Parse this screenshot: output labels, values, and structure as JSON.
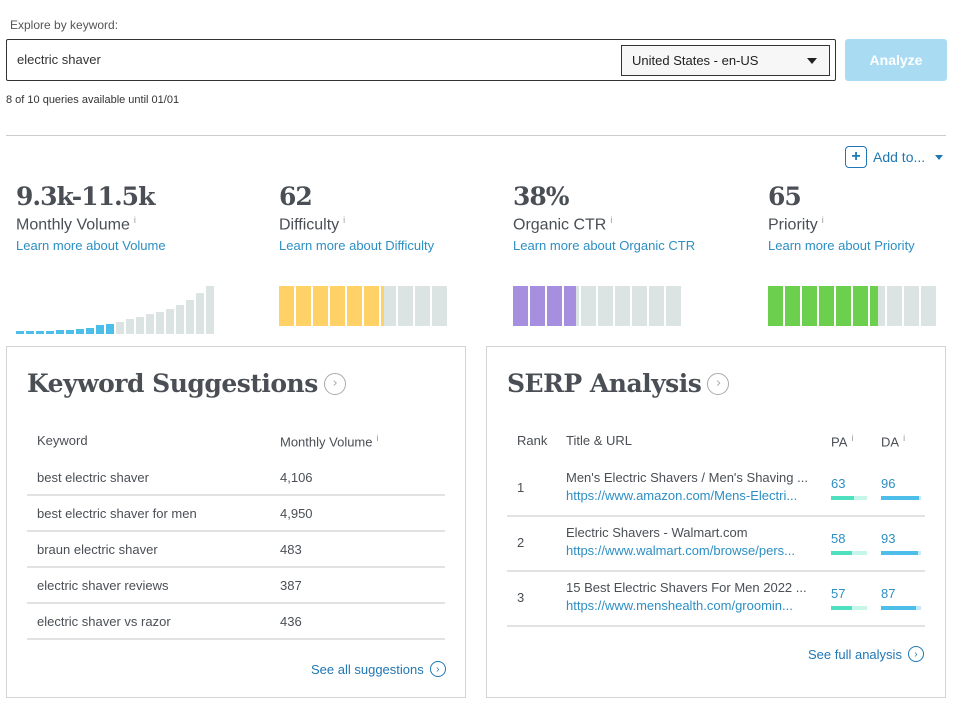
{
  "search": {
    "label": "Explore by keyword:",
    "value": "electric shaver",
    "locale": "United States - en-US",
    "analyze": "Analyze",
    "quota": "8 of 10 queries available until 01/01"
  },
  "add_to": "Add to...",
  "metrics": [
    {
      "value": "9.3k-11.5k",
      "name": "Monthly Volume",
      "link": "Learn more about Volume",
      "trend": [
        1,
        1,
        1.2,
        1.3,
        1.5,
        1.6,
        2,
        2.4,
        3.3,
        3.8,
        4.6,
        5.4,
        6.2,
        7.3,
        8.1,
        9.3,
        10.6,
        12.4,
        14.9,
        17.3
      ],
      "trend_highlight_count": 10,
      "color": "#4dbde9"
    },
    {
      "value": "62",
      "name": "Difficulty",
      "link": "Learn more about Difficulty",
      "level": 62,
      "color": "#ffd166"
    },
    {
      "value": "38%",
      "name": "Organic CTR",
      "link": "Learn more about Organic CTR",
      "level": 38,
      "color": "#a78fe0"
    },
    {
      "value": "65",
      "name": "Priority",
      "link": "Learn more about Priority",
      "level": 65,
      "color": "#6cd04e"
    }
  ],
  "info_icon": "i",
  "keywords": {
    "title": "Keyword Suggestions",
    "headers": [
      "Keyword",
      "Monthly Volume"
    ],
    "rows": [
      [
        "best electric shaver",
        "4,106"
      ],
      [
        "best electric shaver for men",
        "4,950"
      ],
      [
        "braun electric shaver",
        "483"
      ],
      [
        "electric shaver reviews",
        "387"
      ],
      [
        "electric shaver vs razor",
        "436"
      ]
    ],
    "more": "See all suggestions"
  },
  "serp": {
    "title": "SERP Analysis",
    "headers": [
      "Rank",
      "Title & URL",
      "PA",
      "DA"
    ],
    "rows": [
      {
        "rank": "1",
        "title": "Men's Electric Shavers / Men's Shaving ...",
        "url": "https://www.amazon.com/Mens-Electri...",
        "pa": 63,
        "da": 96
      },
      {
        "rank": "2",
        "title": "Electric Shavers - Walmart.com",
        "url": "https://www.walmart.com/browse/pers...",
        "pa": 58,
        "da": 93
      },
      {
        "rank": "3",
        "title": "15 Best Electric Shavers For Men 2022 ...",
        "url": "https://www.menshealth.com/groomin...",
        "pa": 57,
        "da": 87
      }
    ],
    "pa_color": "#4fe0c0",
    "da_color": "#4dbde9",
    "more": "See full analysis"
  }
}
